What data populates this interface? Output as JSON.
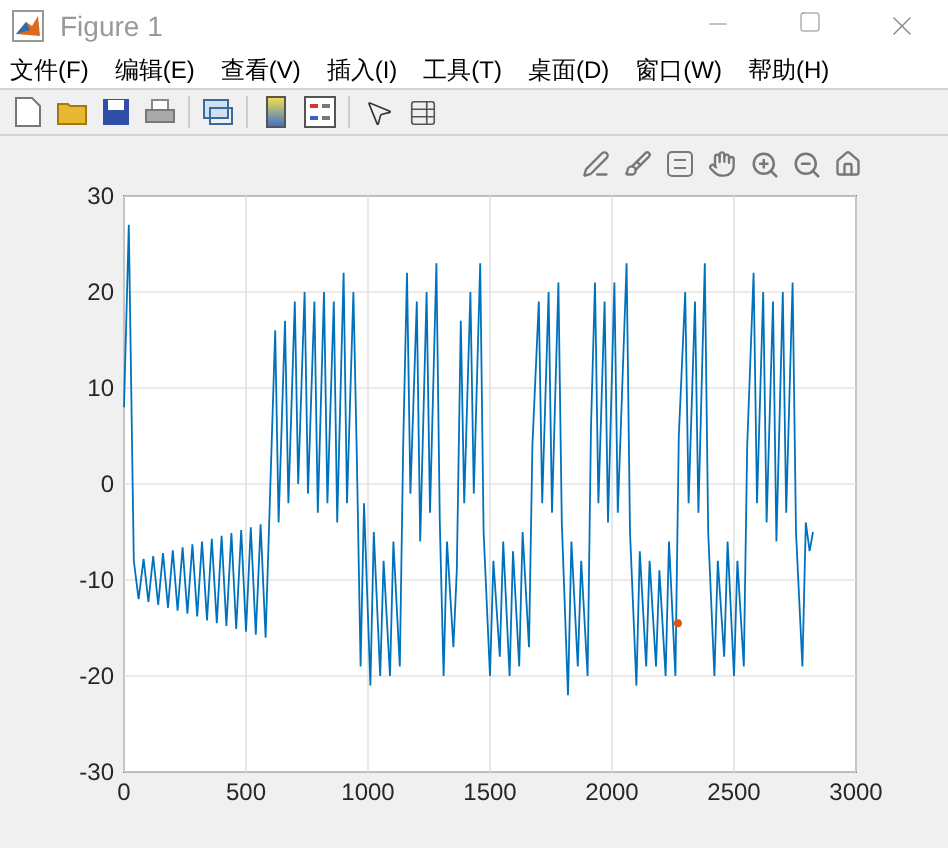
{
  "window": {
    "title": "Figure 1"
  },
  "menu": [
    {
      "label": "文件(F)"
    },
    {
      "label": "编辑(E)"
    },
    {
      "label": "查看(V)"
    },
    {
      "label": "插入(I)"
    },
    {
      "label": "工具(T)"
    },
    {
      "label": "桌面(D)"
    },
    {
      "label": "窗口(W)"
    },
    {
      "label": "帮助(H)"
    }
  ],
  "chart": {
    "chart_data": {
      "type": "line",
      "grid": true,
      "xlim": [
        0,
        3000
      ],
      "ylim": [
        -30,
        30
      ],
      "xticks": [
        0,
        500,
        1000,
        1500,
        2000,
        2500,
        3000
      ],
      "yticks": [
        -30,
        -20,
        -10,
        0,
        10,
        20,
        30
      ],
      "x": [
        0,
        20,
        40,
        60,
        80,
        100,
        120,
        140,
        160,
        180,
        200,
        220,
        240,
        260,
        280,
        300,
        320,
        340,
        360,
        380,
        400,
        420,
        440,
        460,
        480,
        500,
        520,
        540,
        560,
        580,
        620,
        634,
        660,
        674,
        700,
        714,
        740,
        754,
        780,
        794,
        820,
        834,
        860,
        874,
        900,
        914,
        940,
        954,
        970,
        984,
        1010,
        1024,
        1050,
        1064,
        1090,
        1104,
        1130,
        1144,
        1160,
        1174,
        1200,
        1214,
        1240,
        1254,
        1280,
        1294,
        1310,
        1324,
        1350,
        1364,
        1380,
        1394,
        1420,
        1434,
        1460,
        1474,
        1500,
        1514,
        1540,
        1554,
        1580,
        1594,
        1620,
        1634,
        1660,
        1674,
        1700,
        1714,
        1740,
        1754,
        1780,
        1794,
        1820,
        1834,
        1860,
        1874,
        1900,
        1914,
        1930,
        1944,
        1970,
        1984,
        2010,
        2024,
        2060,
        2074,
        2100,
        2114,
        2140,
        2154,
        2180,
        2194,
        2220,
        2234,
        2260,
        2274,
        2300,
        2314,
        2340,
        2354,
        2380,
        2394,
        2420,
        2434,
        2460,
        2474,
        2500,
        2514,
        2540,
        2554,
        2580,
        2594,
        2620,
        2634,
        2660,
        2674,
        2700,
        2714,
        2740,
        2754,
        2780,
        2794,
        2810,
        2824
      ],
      "series": [
        {
          "color": "#0072bd",
          "values": [
            8,
            27,
            -8,
            -12.0,
            -7.8,
            -12.3,
            -7.5,
            -12.6,
            -7.2,
            -12.9,
            -6.9,
            -13.2,
            -6.6,
            -13.5,
            -6.3,
            -13.8,
            -6.0,
            -14.2,
            -5.7,
            -14.5,
            -5.4,
            -14.8,
            -5.1,
            -15.1,
            -4.8,
            -15.4,
            -4.5,
            -15.7,
            -4.2,
            -16.0,
            16,
            -4,
            17,
            -2,
            19,
            0,
            20,
            -1,
            19,
            -3,
            20,
            -2,
            19,
            -4,
            22,
            -2,
            20,
            3,
            -19,
            -2,
            -21,
            -5,
            -20,
            -8,
            -20,
            -6,
            -19,
            4,
            22,
            -1,
            19,
            -6,
            20,
            -3,
            23,
            -4,
            -20,
            -6,
            -17,
            -9,
            17,
            -2,
            20,
            -1,
            23,
            -5,
            -20,
            -8,
            -18,
            -6,
            -20,
            -7,
            -19,
            -5,
            -17,
            4,
            19,
            -2,
            20,
            -3,
            21,
            -4,
            -22,
            -6,
            -19,
            -8,
            -20,
            6,
            21,
            -2,
            19,
            -4,
            21,
            -3,
            23,
            -5,
            -21,
            -7,
            -19,
            -8,
            -19,
            -9,
            -20,
            -6,
            -20,
            5,
            20,
            -2,
            19,
            -3,
            23,
            -5,
            -20,
            -8,
            -18,
            -6,
            -20,
            -8,
            -19,
            4,
            22,
            -2,
            20,
            -4,
            19,
            -6,
            20,
            -3,
            21,
            -5,
            -19,
            -4,
            -7,
            -5
          ]
        }
      ]
    }
  }
}
